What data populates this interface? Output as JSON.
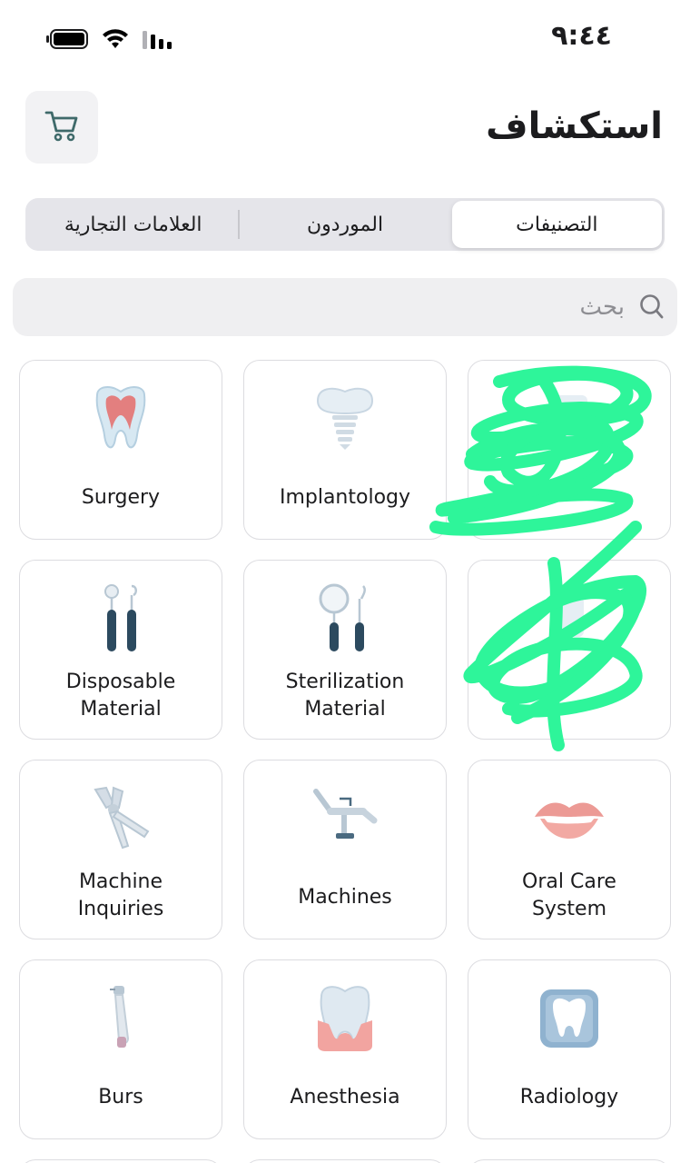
{
  "status_bar": {
    "time": "٩:٤٤"
  },
  "header": {
    "title": "استكشاف"
  },
  "segments": [
    {
      "label": "التصنيفات",
      "active": true
    },
    {
      "label": "الموردون",
      "active": false
    },
    {
      "label": "العلامات التجارية",
      "active": false
    }
  ],
  "search": {
    "placeholder": "بحث"
  },
  "categories": [
    {
      "label": "Surgery",
      "icon": "tooth-root-icon"
    },
    {
      "label": "Implantology",
      "icon": "dental-implant-icon"
    },
    {
      "label": "",
      "icon": "redacted-icon"
    },
    {
      "label": "Disposable\nMaterial",
      "icon": "dental-probes-icon"
    },
    {
      "label": "Sterilization\nMaterial",
      "icon": "mirror-probe-icon"
    },
    {
      "label": "",
      "icon": "redacted-icon"
    },
    {
      "label": "Machine\nInquiries",
      "icon": "extraction-forceps-icon"
    },
    {
      "label": "Machines",
      "icon": "dental-chair-icon"
    },
    {
      "label": "Oral Care\nSystem",
      "icon": "lips-icon"
    },
    {
      "label": "Burs",
      "icon": "handpiece-icon"
    },
    {
      "label": "Anesthesia",
      "icon": "tooth-gum-icon"
    },
    {
      "label": "Radiology",
      "icon": "tooth-xray-icon"
    }
  ],
  "colors": {
    "scribble": "#2ef59a",
    "accent_icon": "#3f6a6a"
  }
}
